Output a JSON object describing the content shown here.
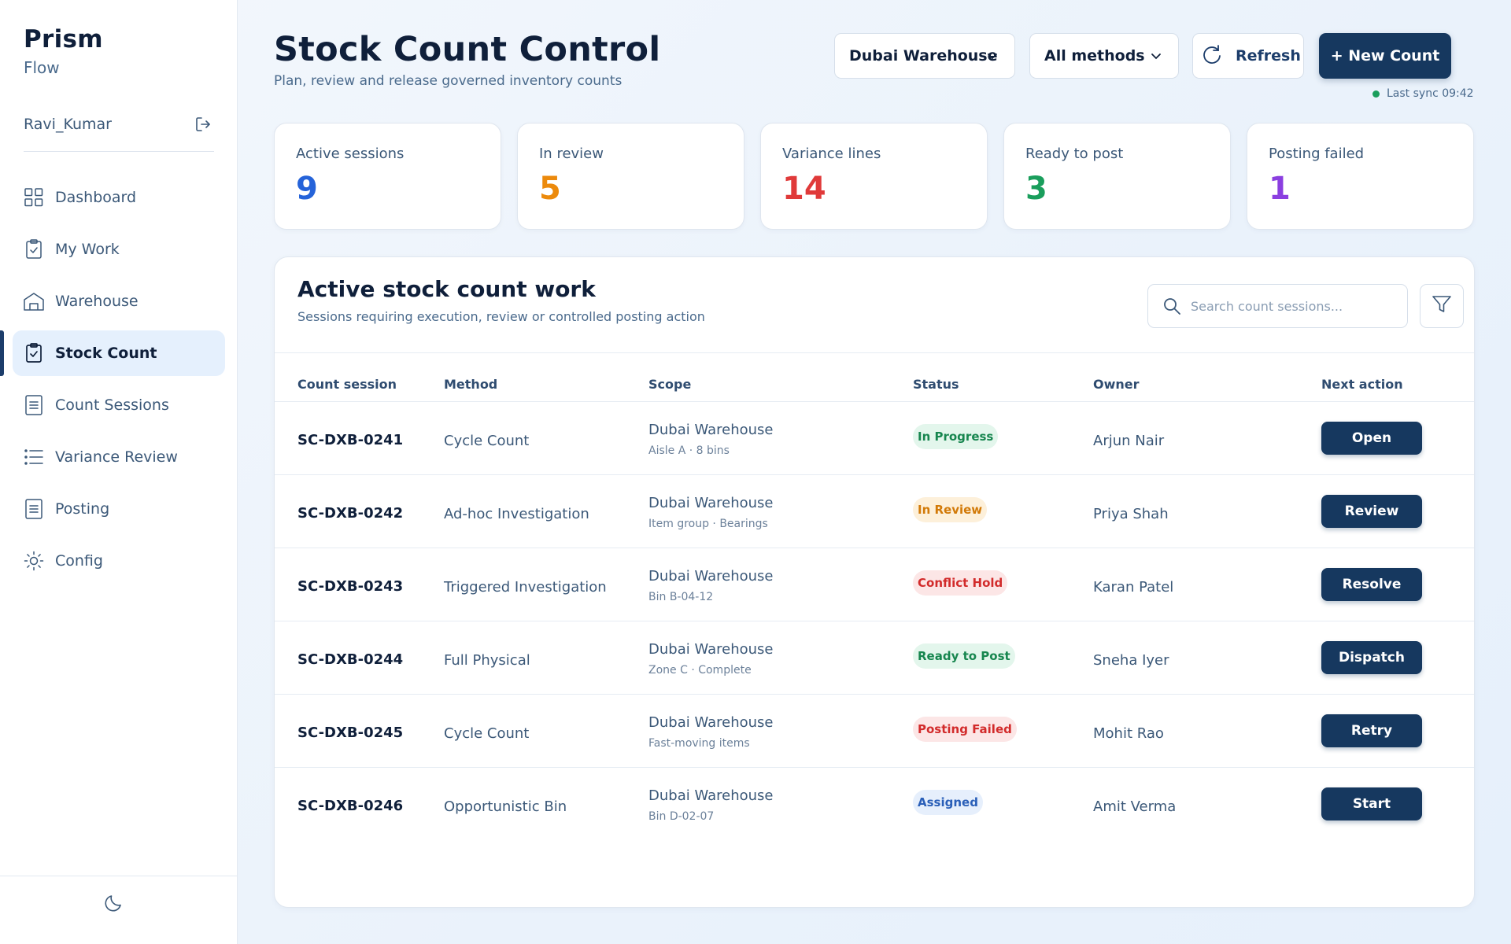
{
  "sidebar": {
    "brand": "Prism",
    "brand_sub": "Flow",
    "user": "Ravi_Kumar",
    "items": [
      {
        "label": "Dashboard"
      },
      {
        "label": "My Work"
      },
      {
        "label": "Warehouse"
      },
      {
        "label": "Stock Count"
      },
      {
        "label": "Count Sessions"
      },
      {
        "label": "Variance Review"
      },
      {
        "label": "Posting"
      },
      {
        "label": "Config"
      }
    ]
  },
  "header": {
    "title": "Stock Count Control",
    "subtitle": "Plan, review and release governed inventory counts",
    "warehouse_select": "Dubai Warehouse",
    "method_select": "All methods",
    "refresh_label": "Refresh",
    "new_count_label": "+ New Count",
    "sync_text": "Last sync 09:42"
  },
  "kpis": [
    {
      "label": "Active sessions",
      "value": "9",
      "color": "#2563d9"
    },
    {
      "label": "In review",
      "value": "5",
      "color": "#ec8a0c"
    },
    {
      "label": "Variance lines",
      "value": "14",
      "color": "#e03a3a"
    },
    {
      "label": "Ready to post",
      "value": "3",
      "color": "#1a9e5c"
    },
    {
      "label": "Posting failed",
      "value": "1",
      "color": "#8b3fe0"
    }
  ],
  "panel": {
    "title": "Active stock count work",
    "subtitle": "Sessions requiring execution, review or controlled posting action",
    "search_placeholder": "Search count sessions..."
  },
  "table": {
    "columns": [
      "Count session",
      "Method",
      "Scope",
      "Status",
      "Owner",
      "Next action"
    ],
    "rows": [
      {
        "id": "SC-DXB-0241",
        "method": "Cycle Count",
        "scope": "Dubai Warehouse",
        "scope_detail": "Aisle A · 8 bins",
        "status": "In Progress",
        "owner": "Arjun Nair",
        "action": "Open"
      },
      {
        "id": "SC-DXB-0242",
        "method": "Ad-hoc Investigation",
        "scope": "Dubai Warehouse",
        "scope_detail": "Item group · Bearings",
        "status": "In Review",
        "owner": "Priya Shah",
        "action": "Review"
      },
      {
        "id": "SC-DXB-0243",
        "method": "Triggered Investigation",
        "scope": "Dubai Warehouse",
        "scope_detail": "Bin B-04-12",
        "status": "Conflict Hold",
        "owner": "Karan Patel",
        "action": "Resolve"
      },
      {
        "id": "SC-DXB-0244",
        "method": "Full Physical",
        "scope": "Dubai Warehouse",
        "scope_detail": "Zone C · Complete",
        "status": "Ready to Post",
        "owner": "Sneha Iyer",
        "action": "Dispatch"
      },
      {
        "id": "SC-DXB-0245",
        "method": "Cycle Count",
        "scope": "Dubai Warehouse",
        "scope_detail": "Fast-moving items",
        "status": "Posting Failed",
        "owner": "Mohit Rao",
        "action": "Retry"
      },
      {
        "id": "SC-DXB-0246",
        "method": "Opportunistic Bin",
        "scope": "Dubai Warehouse",
        "scope_detail": "Bin D-02-07",
        "status": "Assigned",
        "owner": "Amit Verma",
        "action": "Start"
      }
    ]
  },
  "status_colors": {
    "In Progress": {
      "fg": "#17864f",
      "bg": "#e3f6ec"
    },
    "In Review": {
      "fg": "#d27a08",
      "bg": "#fdf0da"
    },
    "Conflict Hold": {
      "fg": "#d22b2b",
      "bg": "#fce6e6"
    },
    "Ready to Post": {
      "fg": "#17864f",
      "bg": "#e3f6ec"
    },
    "Posting Failed": {
      "fg": "#d22b2b",
      "bg": "#fce6e6"
    },
    "Assigned": {
      "fg": "#2a5fb8",
      "bg": "#e6effc"
    }
  }
}
